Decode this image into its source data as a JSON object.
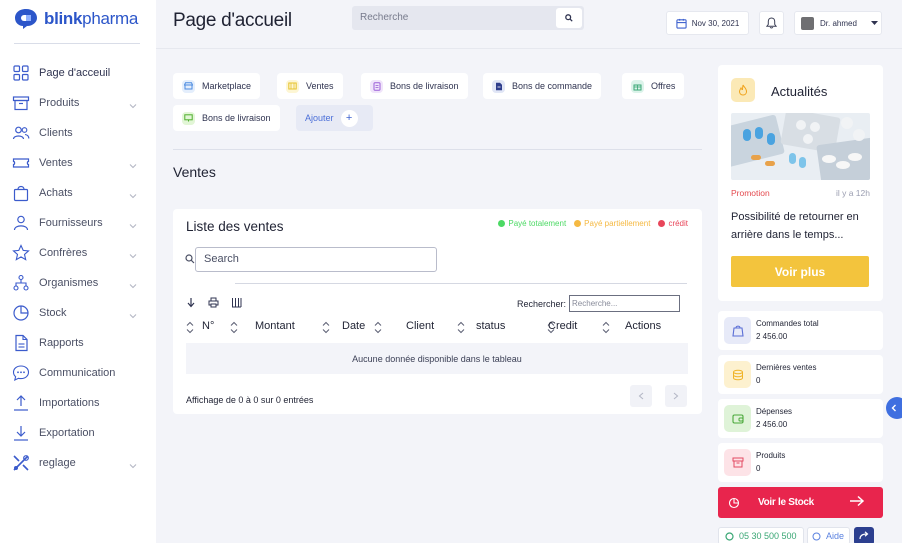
{
  "brand": {
    "name_bold": "blink",
    "name_rest": "pharma"
  },
  "sidebar": {
    "items": [
      {
        "label": "Page d'acceuil",
        "icon": "grid-icon",
        "chevron": false
      },
      {
        "label": "Produits",
        "icon": "box-icon",
        "chevron": true
      },
      {
        "label": "Clients",
        "icon": "users-icon",
        "chevron": false
      },
      {
        "label": "Ventes",
        "icon": "ticket-icon",
        "chevron": true
      },
      {
        "label": "Achats",
        "icon": "bag-icon",
        "chevron": true
      },
      {
        "label": "Fournisseurs",
        "icon": "user-icon",
        "chevron": true
      },
      {
        "label": "Confrères",
        "icon": "star-icon",
        "chevron": true
      },
      {
        "label": "Organismes",
        "icon": "org-icon",
        "chevron": true
      },
      {
        "label": "Stock",
        "icon": "pie-icon",
        "chevron": true
      },
      {
        "label": "Rapports",
        "icon": "file-icon",
        "chevron": false
      },
      {
        "label": "Communication",
        "icon": "chat-icon",
        "chevron": false
      },
      {
        "label": "Importations",
        "icon": "upload-icon",
        "chevron": false
      },
      {
        "label": "Exportation",
        "icon": "download-icon",
        "chevron": false
      },
      {
        "label": "reglage",
        "icon": "tools-icon",
        "chevron": true
      }
    ]
  },
  "header": {
    "title": "Page d'accueil",
    "search_placeholder": "Recherche",
    "date": "Nov 30, 2021",
    "user": "Dr. ahmed"
  },
  "shortcuts": {
    "row1": [
      "Marketplace",
      "Ventes",
      "Bons de livraison",
      "Bons de commande",
      "Offres"
    ],
    "row2": [
      "Bons de livraison"
    ],
    "add_label": "Ajouter"
  },
  "section_title": "Ventes",
  "sales": {
    "title": "Liste des ventes",
    "legend": [
      {
        "label": "Payé totalement",
        "color": "#4cd964"
      },
      {
        "label": "Payé partiellement",
        "color": "#f5b942"
      },
      {
        "label": "crédit",
        "color": "#e8465a"
      }
    ],
    "search_placeholder": "Search",
    "rechercher_label": "Rechercher:",
    "rechercher_placeholder": "Recherche...",
    "columns": [
      "N°",
      "Montant",
      "Date",
      "Client",
      "status",
      "Credit",
      "Actions"
    ],
    "empty": "Aucune donnée disponible dans le tableau",
    "info": "Affichage de 0 à 0 sur 0 entrées"
  },
  "news": {
    "title": "Actualités",
    "tag": "Promotion",
    "ago": "il y a 12h",
    "text": "Possibilité de retourner en arrière dans le temps...",
    "button": "Voir plus"
  },
  "stats": [
    {
      "label": "Commandes total",
      "value": "2 456.00",
      "bg": "#e7eaf8",
      "color": "#5b6fd6"
    },
    {
      "label": "Dernières ventes",
      "value": "0",
      "bg": "#fdf1cf",
      "color": "#f0b429"
    },
    {
      "label": "Dépenses",
      "value": "2 456.00",
      "bg": "#dff3d8",
      "color": "#4aa83a"
    },
    {
      "label": "Produits",
      "value": "0",
      "bg": "#fde3e7",
      "color": "#e24a62"
    }
  ],
  "stock_button": "Voir le Stock",
  "footer": {
    "phone": "05 30 500 500",
    "help": "Aide"
  },
  "colors": {
    "primary": "#2c56c9",
    "accent_red": "#e8254d",
    "accent_yellow": "#f3c43d"
  }
}
